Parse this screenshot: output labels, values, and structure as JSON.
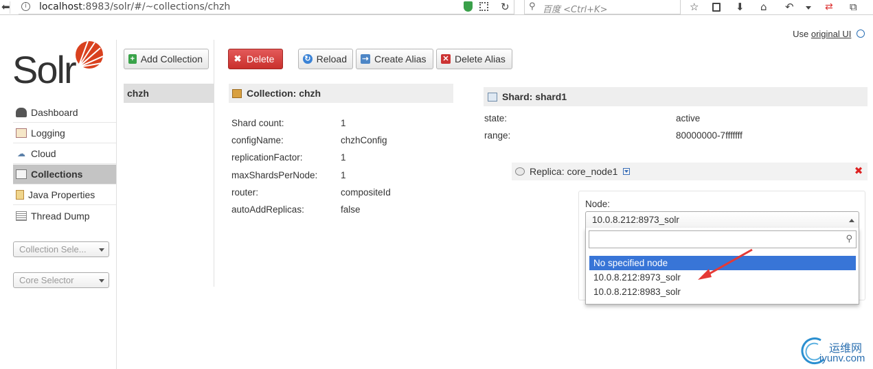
{
  "browser": {
    "url_host": "localhost",
    "url_rest": ":8983/solr/#/~collections/chzh",
    "search_placeholder": "百度 <Ctrl+K>"
  },
  "header": {
    "use_prefix": "Use ",
    "original_ui_link": "original UI"
  },
  "logo": {
    "text": "Solr"
  },
  "sidebar": {
    "items": [
      {
        "label": "Dashboard",
        "icon": "dashboard-icon"
      },
      {
        "label": "Logging",
        "icon": "logging-icon"
      },
      {
        "label": "Cloud",
        "icon": "cloud-icon"
      },
      {
        "label": "Collections",
        "icon": "collections-icon",
        "active": true
      },
      {
        "label": "Java Properties",
        "icon": "java-icon"
      },
      {
        "label": "Thread Dump",
        "icon": "thread-dump-icon"
      }
    ],
    "collection_selector": "Collection Sele...",
    "core_selector": "Core Selector"
  },
  "toolbar": {
    "add_collection": "Add Collection",
    "delete": "Delete",
    "reload": "Reload",
    "create_alias": "Create Alias",
    "delete_alias": "Delete Alias"
  },
  "collections": [
    "chzh"
  ],
  "collection": {
    "title": "Collection: chzh",
    "props": [
      {
        "key": "Shard count:",
        "value": "1"
      },
      {
        "key": "configName:",
        "value": "chzhConfig"
      },
      {
        "key": "replicationFactor:",
        "value": "1"
      },
      {
        "key": "maxShardsPerNode:",
        "value": "1"
      },
      {
        "key": "router:",
        "value": "compositeId"
      },
      {
        "key": "autoAddReplicas:",
        "value": "false"
      }
    ]
  },
  "shard": {
    "title": "Shard: shard1",
    "props": [
      {
        "key": "state:",
        "value": "active"
      },
      {
        "key": "range:",
        "value": "80000000-7fffffff"
      }
    ]
  },
  "replica": {
    "title": "Replica: core_node1",
    "node_label": "Node:",
    "node_selected": "10.0.8.212:8973_solr",
    "options": [
      "No specified node",
      "10.0.8.212:8973_solr",
      "10.0.8.212:8983_solr"
    ]
  },
  "watermark": {
    "cn": "运维网",
    "domain": "iyunv.com"
  },
  "colors": {
    "accent_red": "#c9302c",
    "highlight_blue": "#3875d7",
    "solr_orange": "#d9411e"
  }
}
